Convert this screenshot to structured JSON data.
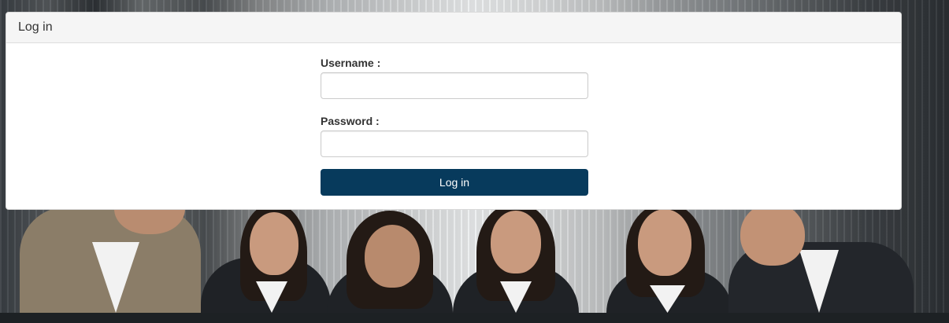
{
  "panel": {
    "title": "Log in"
  },
  "form": {
    "username_label": "Username :",
    "username_value": "",
    "password_label": "Password :",
    "password_value": "",
    "submit_label": "Log in"
  },
  "colors": {
    "button_bg": "#073a5c",
    "panel_heading_bg": "#f5f5f5"
  }
}
